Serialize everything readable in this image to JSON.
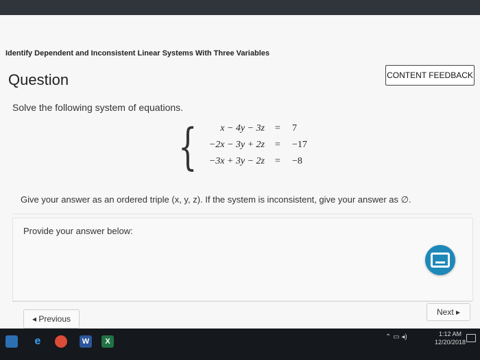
{
  "header": {
    "lesson_title": "Identify Dependent and Inconsistent Linear Systems With Three Variables",
    "feedback_label": "CONTENT FEEDBACK"
  },
  "question": {
    "heading": "Question",
    "prompt": "Solve the following system of equations.",
    "equations": [
      {
        "lhs": "x − 4y − 3z",
        "sign": "=",
        "rhs": "7"
      },
      {
        "lhs": "−2x − 3y + 2z",
        "sign": "=",
        "rhs": "−17"
      },
      {
        "lhs": "−3x + 3y − 2z",
        "sign": "=",
        "rhs": "−8"
      }
    ],
    "instructions": "Give your answer as an ordered triple (x, y, z). If the system is inconsistent, give your answer as ∅."
  },
  "answer": {
    "provide_label": "Provide your answer below:"
  },
  "navigation": {
    "previous_label": "◂ Previous",
    "next_label": "Next ▸"
  },
  "taskbar": {
    "time": "1:12 AM",
    "date": "12/20/2018",
    "apps": [
      "edge-icon",
      "chrome-icon",
      "word-icon",
      "excel-icon"
    ]
  },
  "colors": {
    "accent": "#1e88b8"
  }
}
